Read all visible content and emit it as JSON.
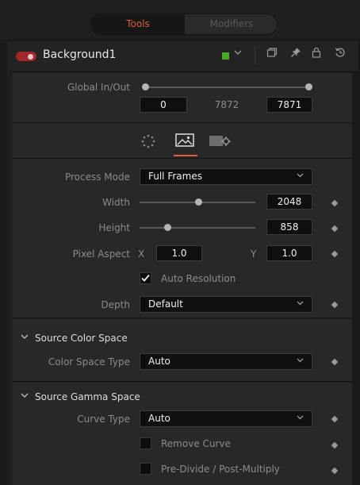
{
  "tabs": {
    "tools": "Tools",
    "modifiers": "Modifiers"
  },
  "header": {
    "node_name": "Background1",
    "swatch_color": "#4aa829",
    "icons": [
      "chevron-down-icon",
      "version-icon",
      "pin-icon",
      "lock-icon",
      "reset-icon"
    ]
  },
  "global": {
    "label": "Global In/Out",
    "in_value": "0",
    "duration": "7872",
    "out_value": "7871"
  },
  "iconbar": {
    "tabs": [
      "dots-icon",
      "image-icon",
      "settings-icon"
    ],
    "active_index": 1,
    "accent": "#e25a3c"
  },
  "main": {
    "process_mode": {
      "label": "Process Mode",
      "value": "Full Frames"
    },
    "width": {
      "label": "Width",
      "value": "2048"
    },
    "height": {
      "label": "Height",
      "value": "858"
    },
    "pixel_aspect": {
      "label": "Pixel Aspect",
      "x_label": "X",
      "x_value": "1.0",
      "y_label": "Y",
      "y_value": "1.0"
    },
    "auto_resolution": {
      "label": "Auto Resolution",
      "checked": true
    },
    "depth": {
      "label": "Depth",
      "value": "Default"
    }
  },
  "source_color_space": {
    "title": "Source Color Space",
    "color_space_type": {
      "label": "Color Space Type",
      "value": "Auto"
    }
  },
  "source_gamma_space": {
    "title": "Source Gamma Space",
    "curve_type": {
      "label": "Curve Type",
      "value": "Auto"
    },
    "remove_curve": {
      "label": "Remove Curve",
      "checked": false
    },
    "pre_divide": {
      "label": "Pre-Divide / Post-Multiply",
      "checked": false
    }
  }
}
